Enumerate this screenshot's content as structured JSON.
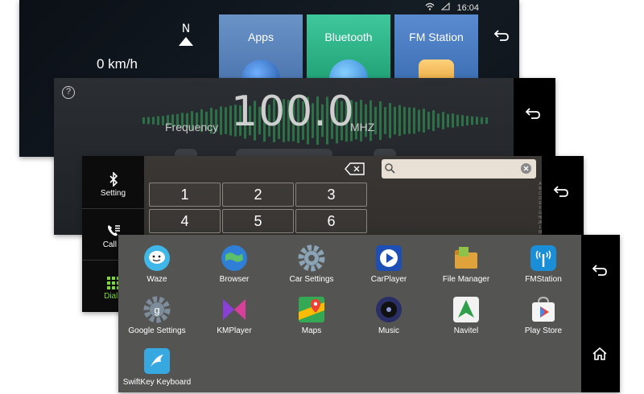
{
  "home": {
    "time": "16:04",
    "compass": "N",
    "speed": "0 km/h",
    "tiles": [
      {
        "label": "Apps"
      },
      {
        "label": "Bluetooth"
      },
      {
        "label": "FM Station"
      }
    ]
  },
  "radio": {
    "frequency": "100.0",
    "frequency_label": "Frequency",
    "unit": "MHZ",
    "help": "?"
  },
  "phone": {
    "nav": [
      {
        "label": "Setting",
        "icon": "bluetooth-icon"
      },
      {
        "label": "Call L",
        "icon": "call-log-icon"
      },
      {
        "label": "Dialp",
        "icon": "dialpad-icon"
      }
    ],
    "keys": [
      "1",
      "2",
      "3",
      "4",
      "5",
      "6"
    ],
    "alphabet": "ABCDEFGHIJKLMNOPQRSTUVWXYZ#"
  },
  "drawer": {
    "apps": [
      {
        "label": "Waze",
        "color": "#3fb7e8",
        "icon": "waze-icon"
      },
      {
        "label": "Browser",
        "color": "#2f7fd6",
        "icon": "browser-icon"
      },
      {
        "label": "Car Settings",
        "color": "#8aa3b5",
        "icon": "settings-gear-icon"
      },
      {
        "label": "CarPlayer",
        "color": "#1e4fb5",
        "icon": "carplayer-icon"
      },
      {
        "label": "File Manager",
        "color": "#e0a33c",
        "icon": "file-manager-icon"
      },
      {
        "label": "FMStation",
        "color": "#1a8fd8",
        "icon": "fm-station-icon"
      },
      {
        "label": "Google Settings",
        "color": "#7d8d9c",
        "icon": "google-settings-icon"
      },
      {
        "label": "KMPlayer",
        "color": "#8a3fd6",
        "icon": "kmplayer-icon"
      },
      {
        "label": "Maps",
        "color": "#34a853",
        "icon": "maps-icon"
      },
      {
        "label": "Music",
        "color": "#2a2f66",
        "icon": "music-icon"
      },
      {
        "label": "Navitel",
        "color": "#2f9e4a",
        "icon": "navitel-icon"
      },
      {
        "label": "Play Store",
        "color": "#e94335",
        "icon": "play-store-icon"
      },
      {
        "label": "SwiftKey Keyboard",
        "color": "#38a8e0",
        "icon": "swiftkey-icon"
      }
    ]
  }
}
